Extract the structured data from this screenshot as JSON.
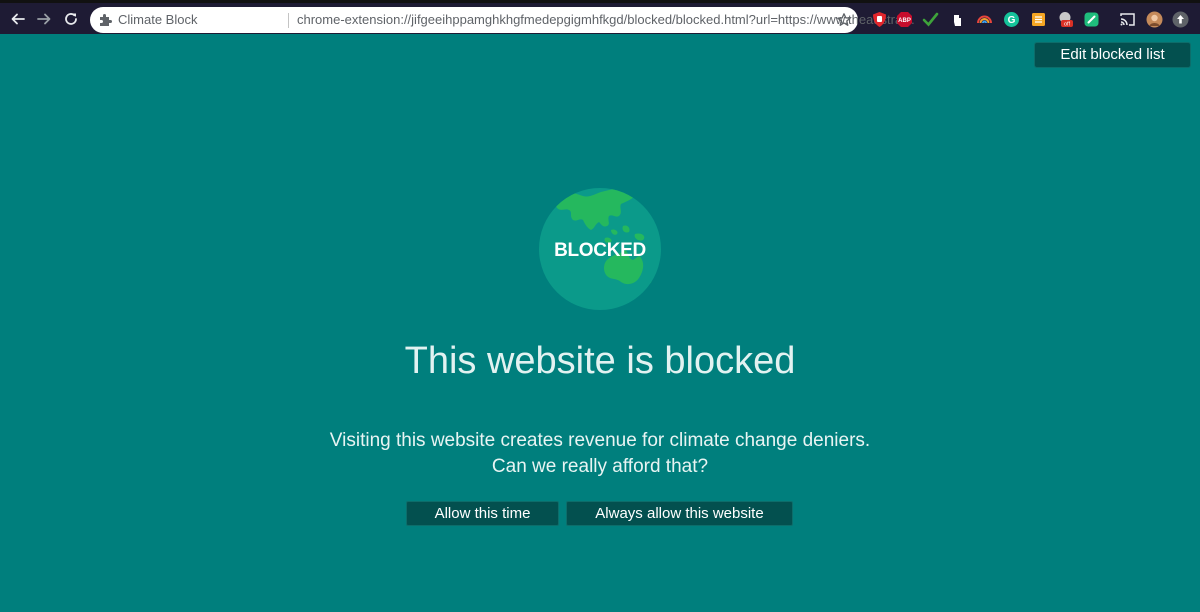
{
  "browser": {
    "tab_title": "Climate Block",
    "url": "chrome-extension://jifgeeihppamghkhgfmedepgigmhfkgd/blocked/blocked.html?url=https://www.theaustralian.co...",
    "icons": {
      "back": "back-arrow-icon",
      "forward": "forward-arrow-icon",
      "reload": "reload-icon",
      "extension": "puzzle-icon",
      "bookmark": "star-icon"
    },
    "extensions": [
      {
        "name": "ublock-icon",
        "color": "#e1262c"
      },
      {
        "name": "adblock-plus-icon",
        "label": "ABP",
        "color": "#c70d2c"
      },
      {
        "name": "checkmark-icon",
        "color": "#3ea33a"
      },
      {
        "name": "glove-icon",
        "color": "#ffffff"
      },
      {
        "name": "rainbow-icon",
        "color": "#f0a030"
      },
      {
        "name": "grammarly-icon",
        "label": "G",
        "color": "#15c39a"
      },
      {
        "name": "stack-icon",
        "color": "#f5a623"
      },
      {
        "name": "shield-off-icon",
        "badge": "off",
        "color": "#d93025"
      },
      {
        "name": "edit-square-icon",
        "color": "#1fbd7c"
      },
      {
        "name": "cast-icon",
        "color": "#ffffff"
      },
      {
        "name": "profile-avatar",
        "color": "#c58a5a"
      },
      {
        "name": "update-icon",
        "color": "#5f6368"
      }
    ]
  },
  "page": {
    "background": "#007f7d",
    "edit_button": "Edit blocked list",
    "globe_label": "BLOCKED",
    "headline": "This website is blocked",
    "message_line1": "Visiting this website creates revenue for climate change deniers.",
    "message_line2": "Can we really afford that?",
    "allow_once_button": "Allow this time",
    "always_allow_button": "Always allow this website"
  }
}
